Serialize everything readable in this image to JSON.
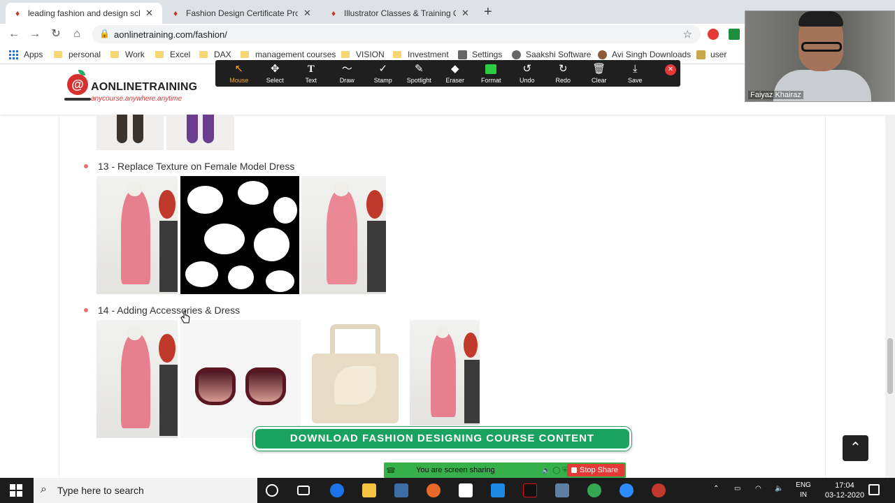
{
  "browser": {
    "tabs": [
      {
        "title": "leading fashion and design scho",
        "active": true
      },
      {
        "title": "Fashion Design Certificate Progr",
        "active": false
      },
      {
        "title": "Illustrator Classes & Training Onl",
        "active": false
      }
    ],
    "url": "aonlinetraining.com/fashion/",
    "bookmarks": [
      "Apps",
      "personal",
      "Work",
      "Excel",
      "DAX",
      "management courses",
      "VISION",
      "Investment",
      "Settings",
      "Saakshi Software",
      "Avi Singh Downloads",
      "user"
    ]
  },
  "zoom_toolbar": {
    "tools": [
      {
        "label": "Mouse",
        "icon": "↖"
      },
      {
        "label": "Select",
        "icon": "✥"
      },
      {
        "label": "Text",
        "icon": "T"
      },
      {
        "label": "Draw",
        "icon": "〜"
      },
      {
        "label": "Stamp",
        "icon": "✓"
      },
      {
        "label": "Spotlight",
        "icon": "✎"
      },
      {
        "label": "Eraser",
        "icon": "◆"
      },
      {
        "label": "Format",
        "icon": ""
      },
      {
        "label": "Undo",
        "icon": "↺"
      },
      {
        "label": "Redo",
        "icon": "↻"
      },
      {
        "label": "Clear",
        "icon": "🗑"
      },
      {
        "label": "Save",
        "icon": "⤓"
      }
    ],
    "active_tool": "Mouse",
    "accent_color": "#f5a623",
    "format_color": "#2ecc40"
  },
  "video": {
    "participant_name": "Faiyaz Khairaz"
  },
  "site": {
    "logo_text": "AONLINETRAINING",
    "logo_tagline": "anycourse.anywhere.anytime",
    "brand_color": "#d63031"
  },
  "sections": [
    {
      "title": "13 - Replace Texture on Female Model Dress"
    },
    {
      "title": "14 - Adding Accessories & Dress"
    }
  ],
  "download_button": {
    "label": "DOWNLOAD FASHION DESIGNING COURSE CONTENT",
    "color": "#1aa260"
  },
  "screen_share": {
    "status": "You are screen sharing",
    "stop_label": "Stop Share"
  },
  "taskbar": {
    "search_placeholder": "Type here to search",
    "language": {
      "line1": "ENG",
      "line2": "IN"
    },
    "time": "17:04",
    "date": "03-12-2020"
  }
}
